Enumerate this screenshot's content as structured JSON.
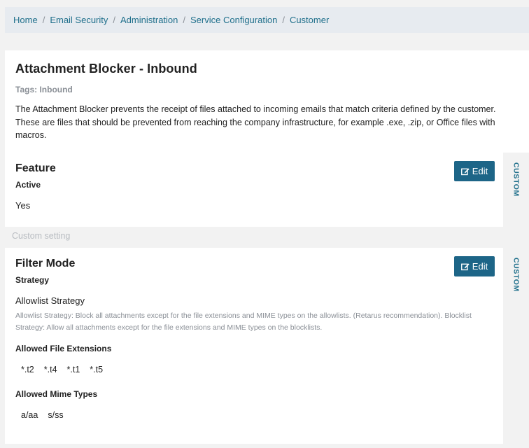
{
  "breadcrumb": [
    "Home",
    "Email Security",
    "Administration",
    "Service Configuration",
    "Customer"
  ],
  "header": {
    "title": "Attachment Blocker - Inbound",
    "tags": "Tags: Inbound",
    "description": "The Attachment Blocker prevents the receipt of files attached to incoming emails that match criteria defined by the customer. These are files that should be prevented from reaching the company infrastructure, for example .exe, .zip, or Office files with macros."
  },
  "feature": {
    "title": "Feature",
    "edit_label": "Edit",
    "side_label": "CUSTOM",
    "active_label": "Active",
    "active_value": "Yes"
  },
  "custom_setting": "Custom setting",
  "filter_mode": {
    "title": "Filter Mode",
    "edit_label": "Edit",
    "side_label": "CUSTOM",
    "strategy_label": "Strategy",
    "strategy_value": "Allowlist Strategy",
    "strategy_hint": "Allowlist Strategy: Block all attachments except for the file extensions and MIME types on the allowlists. (Retarus recommendation). Blocklist Strategy: Allow all attachments except for the file extensions and MIME types on the blocklists.",
    "extensions_label": "Allowed File Extensions",
    "extensions": [
      "*.t2",
      "*.t4",
      "*.t1",
      "*.t5"
    ],
    "mime_label": "Allowed Mime Types",
    "mime_types": [
      "a/aa",
      "s/ss"
    ]
  },
  "colors": {
    "accent": "#1d6587",
    "link": "#1f6f8b",
    "muted": "#8a8f96"
  },
  "icons": {
    "edit": "edit-icon"
  }
}
